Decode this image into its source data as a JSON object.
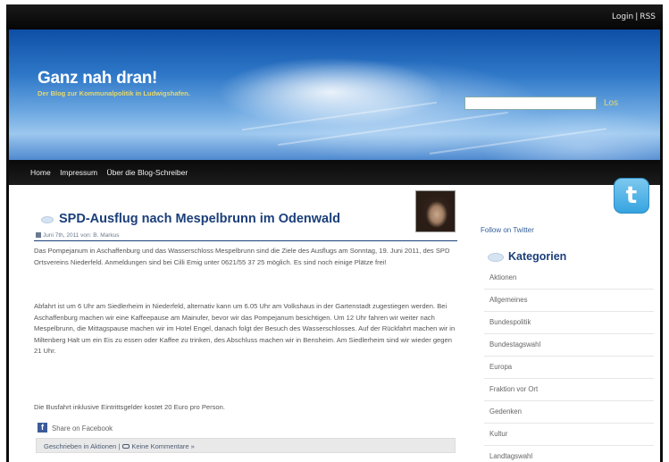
{
  "topbar": {
    "login_label": "Login",
    "separator": "|",
    "rss_label": "RSS"
  },
  "header": {
    "site_title": "Ganz nah dran!",
    "tagline": "Der Blog zur Kommunalpolitik in Ludwigshafen.",
    "search_button": "Los",
    "search_value": ""
  },
  "nav": {
    "items": [
      "Home",
      "Impressum",
      "Über die Blog-Schreiber"
    ]
  },
  "post": {
    "title": "SPD-Ausflug nach Mespelbrunn im Odenwald",
    "meta": "Juni 7th, 2011 von: B. Markus",
    "paragraphs": [
      "Das Pompejanum in Aschaffenburg und das Wasserschloss Mespelbrunn sind die Ziele des Ausflugs am Sonntag, 19. Juni 2011, des SPD Ortsvereins Niederfeld. Anmeldungen sind bei Cilli Emig unter 0621/55 37 25 möglich. Es sind noch einige Plätze frei!",
      "Abfahrt ist um 6 Uhr am Siedlerheim in Niederfeld, alternativ kann um 6.05 Uhr am Volkshaus in der Gartenstadt zugestiegen werden. Bei Aschaffenburg machen wir eine Kaffeepause am Mainufer, bevor wir das Pompejanum besichtigen. Um 12 Uhr fahren wir weiter nach Mespelbrunn, die Mittagspause machen wir im Hotel Engel, danach folgt der Besuch des Wasserschlosses. Auf der Rückfahrt machen wir in Miltenberg Halt um ein Eis zu essen oder Kaffee zu trinken, des Abschluss machen wir in Bensheim. Am Siedlerheim sind wir wieder gegen 21 Uhr.",
      "Die Busfahrt inklusive Eintrittsgelder kostet 20 Euro pro Person."
    ],
    "share_label": "Share on Facebook",
    "footer_category_text": "Geschrieben in Aktionen |",
    "footer_comments_text": "Keine Kommentare »"
  },
  "sidebar": {
    "follow_label": "Follow on Twitter",
    "categories_heading": "Kategorien",
    "categories": [
      "Aktionen",
      "Allgemeines",
      "Bundespolitik",
      "Bundestagswahl",
      "Europa",
      "Fraktion vor Ort",
      "Gedenken",
      "Kultur",
      "Landtagswahl"
    ]
  },
  "colors": {
    "link_blue": "#1b3f7a",
    "tagline_gold": "#e7d96a",
    "nav_bg": "#0d0d0d"
  },
  "icons": {
    "facebook": "facebook-icon",
    "twitter": "twitter-icon",
    "calendar": "calendar-icon",
    "comment": "comment-icon"
  }
}
